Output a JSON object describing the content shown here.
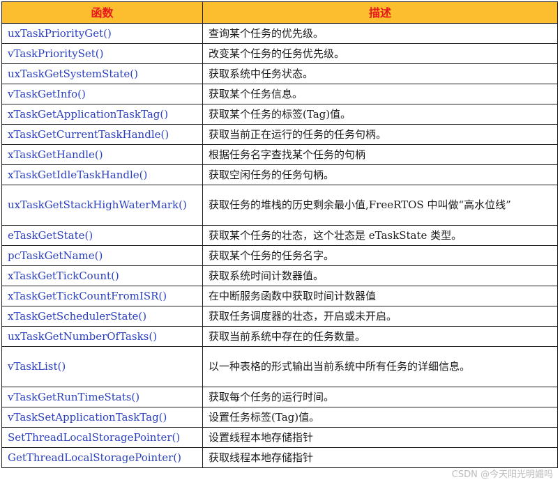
{
  "table": {
    "headers": [
      "函数",
      "描述"
    ],
    "rows": [
      {
        "func": "uxTaskPriorityGet()",
        "desc": "查询某个任务的优先级。"
      },
      {
        "func": "vTaskPrioritySet()",
        "desc": "改变某个任务的任务优先级。"
      },
      {
        "func": "uxTaskGetSystemState()",
        "desc": "获取系统中任务状态。"
      },
      {
        "func": "vTaskGetInfo()",
        "desc": "获取某个任务信息。"
      },
      {
        "func": "xTaskGetApplicationTaskTag()",
        "desc": "获取某个任务的标签(Tag)值。"
      },
      {
        "func": "xTaskGetCurrentTaskHandle()",
        "desc": "获取当前正在运行的任务的任务句柄。"
      },
      {
        "func": "xTaskGetHandle()",
        "desc": "根据任务名字查找某个任务的句柄"
      },
      {
        "func": "xTaskGetIdleTaskHandle()",
        "desc": "获取空闲任务的任务句柄。"
      },
      {
        "func": "uxTaskGetStackHighWaterMark()",
        "desc": "获取任务的堆栈的历史剩余最小值,FreeRTOS 中叫做“高水位线”"
      },
      {
        "func": "eTaskGetState()",
        "desc": "获取某个任务的壮态，这个壮态是 eTaskState 类型。"
      },
      {
        "func": "pcTaskGetName()",
        "desc": "获取某个任务的任务名字。"
      },
      {
        "func": "xTaskGetTickCount()",
        "desc": "获取系统时间计数器值。"
      },
      {
        "func": "xTaskGetTickCountFromISR()",
        "desc": "在中断服务函数中获取时间计数器值"
      },
      {
        "func": "xTaskGetSchedulerState()",
        "desc": "获取任务调度器的壮态，开启或未开启。"
      },
      {
        "func": "uxTaskGetNumberOfTasks()",
        "desc": "获取当前系统中存在的任务数量。"
      },
      {
        "func": "vTaskList()",
        "desc": "以一种表格的形式输出当前系统中所有任务的详细信息。"
      },
      {
        "func": "vTaskGetRunTimeStats()",
        "desc": "获取每个任务的运行时间。"
      },
      {
        "func": "vTaskSetApplicationTaskTag()",
        "desc": "设置任务标签(Tag)值。"
      },
      {
        "func": "SetThreadLocalStoragePointer()",
        "desc": "设置线程本地存储指针"
      },
      {
        "func": "GetThreadLocalStoragePointer()",
        "desc": "获取线程本地存储指针"
      }
    ]
  },
  "watermark": "CSDN @今天阳光明媚吗",
  "colors": {
    "header_bg": "#fcbd2f",
    "header_text": "#e8171b",
    "func_text": "#2a3fbf",
    "border": "#1f1f1f"
  }
}
